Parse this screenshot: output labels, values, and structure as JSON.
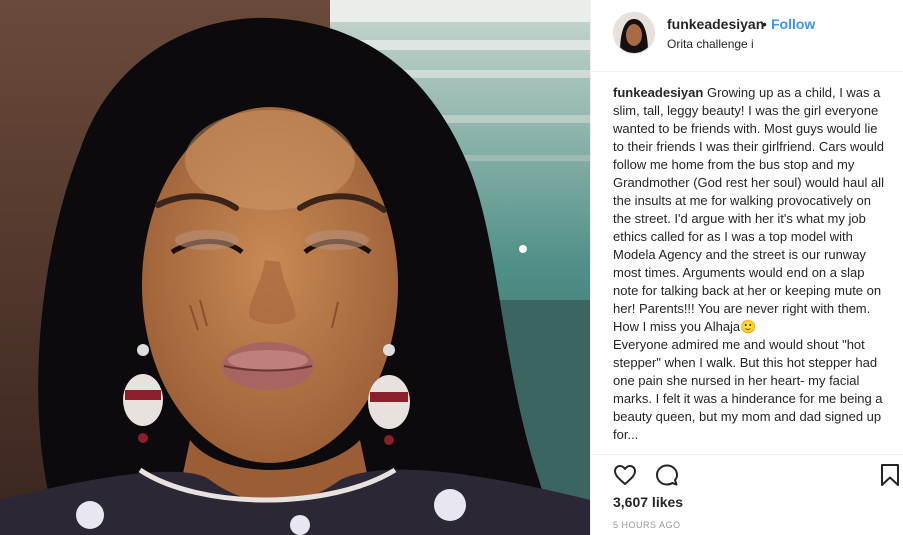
{
  "post": {
    "username": "funkeadesiyan",
    "separator": "•",
    "follow_label": "Follow",
    "location": "Orita challenge i"
  },
  "caption": {
    "username": "funkeadesiyan",
    "text_1": "Growing up as a child, I was a slim, tall, leggy beauty! I was the girl everyone wanted to be friends with. Most guys would lie to their friends I was their girlfriend. Cars would follow me home from the bus stop and my Grandmother (God rest her soul) would haul all the insults at me for walking provocatively on the street. I'd argue with her it's what my job ethics called for as I was a top model with Modela Agency and the street is our runway most times. Arguments would end on a slap note for talking back at her or keeping mute on her! Parents!!! You are never right with them. How I miss you Alhaja",
    "emoji": "🙂",
    "text_2": "Everyone admired me and would shout \"hot stepper\" when I walk. But this hot stepper had one pain she nursed in her heart- my facial marks. I felt it was a hinderance for me being a beauty queen, but my mom and dad signed up for..."
  },
  "stats": {
    "likes": "3,607 likes",
    "time_ago": "5 HOURS AGO"
  },
  "icons": {
    "like": "heart-icon",
    "comment": "comment-icon",
    "save": "bookmark-icon"
  },
  "colors": {
    "follow": "#3897f0",
    "text": "#262626",
    "muted": "#999999"
  }
}
